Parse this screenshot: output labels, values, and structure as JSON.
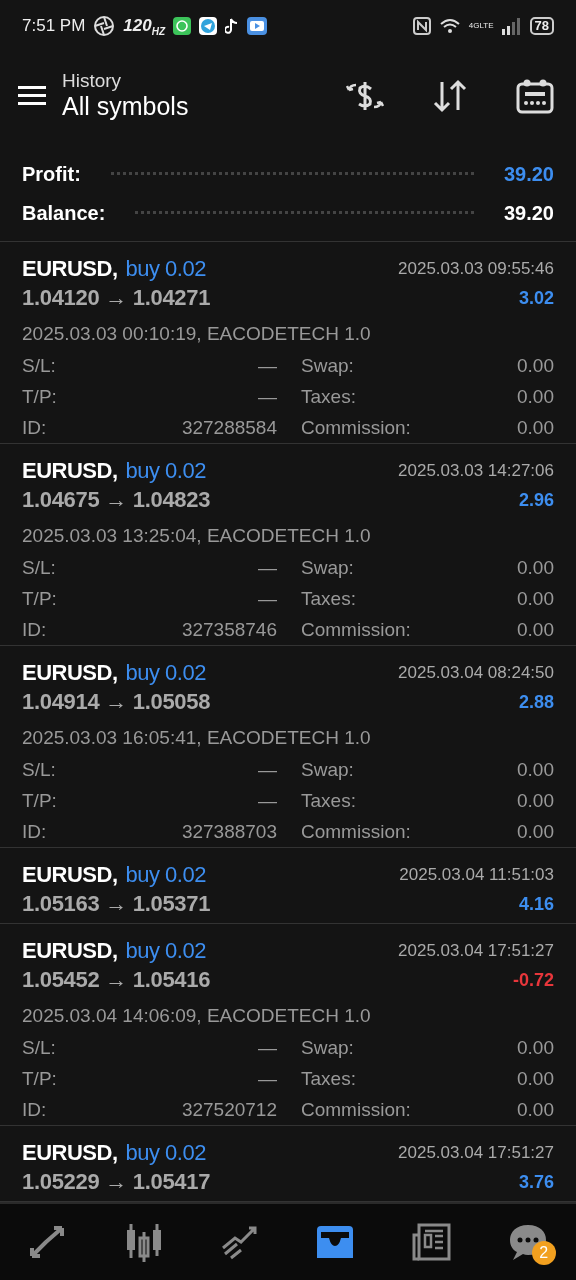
{
  "status_bar": {
    "time": "7:51 PM",
    "refresh_rate": "120",
    "refresh_unit": "HZ",
    "network": "4GLTE",
    "battery": "78"
  },
  "header": {
    "title": "History",
    "subtitle": "All symbols"
  },
  "summary": [
    {
      "label": "Profit:",
      "value": "39.20",
      "color": "#3d8ef0"
    },
    {
      "label": "Balance:",
      "value": "39.20",
      "color": "#ffffff"
    }
  ],
  "trades": [
    {
      "symbol": "EURUSD,",
      "side": "buy 0.02",
      "prices": "1.04120 → 1.04271",
      "close_time": "2025.03.03 09:55:46",
      "profit": "3.02",
      "color": "#3d8ef0",
      "expanded": true,
      "open_info": "2025.03.03 00:10:19, EACODETECH 1.0",
      "details": [
        {
          "label": "S/L:",
          "value": "—"
        },
        {
          "label": "Swap:",
          "value": "0.00"
        },
        {
          "label": "T/P:",
          "value": "—"
        },
        {
          "label": "Taxes:",
          "value": "0.00"
        },
        {
          "label": "ID:",
          "value": "327288584"
        },
        {
          "label": "Commission:",
          "value": "0.00"
        }
      ]
    },
    {
      "symbol": "EURUSD,",
      "side": "buy 0.02",
      "prices": "1.04675 → 1.04823",
      "close_time": "2025.03.03 14:27:06",
      "profit": "2.96",
      "color": "#3d8ef0",
      "expanded": true,
      "open_info": "2025.03.03 13:25:04, EACODETECH 1.0",
      "details": [
        {
          "label": "S/L:",
          "value": "—"
        },
        {
          "label": "Swap:",
          "value": "0.00"
        },
        {
          "label": "T/P:",
          "value": "—"
        },
        {
          "label": "Taxes:",
          "value": "0.00"
        },
        {
          "label": "ID:",
          "value": "327358746"
        },
        {
          "label": "Commission:",
          "value": "0.00"
        }
      ]
    },
    {
      "symbol": "EURUSD,",
      "side": "buy 0.02",
      "prices": "1.04914 → 1.05058",
      "close_time": "2025.03.04 08:24:50",
      "profit": "2.88",
      "color": "#3d8ef0",
      "expanded": true,
      "open_info": "2025.03.03 16:05:41, EACODETECH 1.0",
      "details": [
        {
          "label": "S/L:",
          "value": "—"
        },
        {
          "label": "Swap:",
          "value": "0.00"
        },
        {
          "label": "T/P:",
          "value": "—"
        },
        {
          "label": "Taxes:",
          "value": "0.00"
        },
        {
          "label": "ID:",
          "value": "327388703"
        },
        {
          "label": "Commission:",
          "value": "0.00"
        }
      ]
    },
    {
      "symbol": "EURUSD,",
      "side": "buy 0.02",
      "prices": "1.05163 → 1.05371",
      "close_time": "2025.03.04 11:51:03",
      "profit": "4.16",
      "color": "#3d8ef0",
      "expanded": false
    },
    {
      "symbol": "EURUSD,",
      "side": "buy 0.02",
      "prices": "1.05452 → 1.05416",
      "close_time": "2025.03.04 17:51:27",
      "profit": "-0.72",
      "color": "#e8363b",
      "expanded": true,
      "open_info": "2025.03.04 14:06:09, EACODETECH 1.0",
      "details": [
        {
          "label": "S/L:",
          "value": "—"
        },
        {
          "label": "Swap:",
          "value": "0.00"
        },
        {
          "label": "T/P:",
          "value": "—"
        },
        {
          "label": "Taxes:",
          "value": "0.00"
        },
        {
          "label": "ID:",
          "value": "327520712"
        },
        {
          "label": "Commission:",
          "value": "0.00"
        }
      ]
    },
    {
      "symbol": "EURUSD,",
      "side": "buy 0.02",
      "prices": "1.05229 → 1.05417",
      "close_time": "2025.03.04 17:51:27",
      "profit": "3.76",
      "color": "#3d8ef0",
      "expanded": false
    }
  ],
  "bottom_nav": [
    {
      "kind": "quotes",
      "selected": false
    },
    {
      "kind": "chart",
      "selected": false
    },
    {
      "kind": "trade",
      "selected": false
    },
    {
      "kind": "history",
      "selected": true
    },
    {
      "kind": "news",
      "selected": false
    },
    {
      "kind": "messages",
      "selected": false,
      "badge": "2"
    }
  ]
}
